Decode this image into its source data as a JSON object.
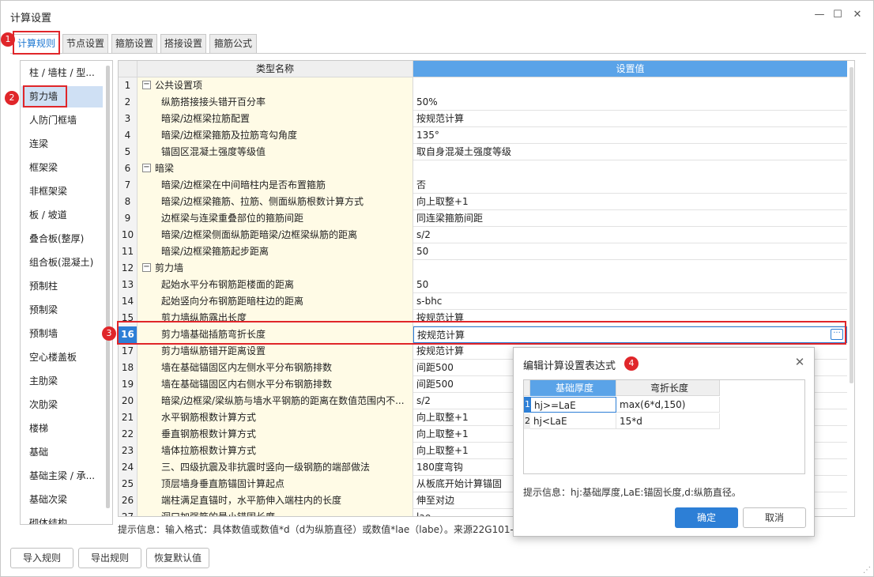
{
  "window": {
    "title": "计算设置",
    "min": "—",
    "max": "☐",
    "close": "✕"
  },
  "tabs": [
    "计算规则",
    "节点设置",
    "箍筋设置",
    "搭接设置",
    "箍筋公式"
  ],
  "categories": [
    "柱 / 墙柱 / 型...",
    "剪力墙",
    "人防门框墙",
    "连梁",
    "框架梁",
    "非框架梁",
    "板 / 坡道",
    "叠合板(整厚)",
    "组合板(混凝土)",
    "预制柱",
    "预制梁",
    "预制墙",
    "空心楼盖板",
    "主肋梁",
    "次肋梁",
    "楼梯",
    "基础",
    "基础主梁 / 承...",
    "基础次梁",
    "砌体结构"
  ],
  "grid": {
    "headers": {
      "name": "类型名称",
      "value": "设置值"
    },
    "rows": [
      {
        "n": "1",
        "name": "公共设置项",
        "value": "",
        "group": true
      },
      {
        "n": "2",
        "name": "纵筋搭接接头错开百分率",
        "value": "50%"
      },
      {
        "n": "3",
        "name": "暗梁/边框梁拉筋配置",
        "value": "按规范计算"
      },
      {
        "n": "4",
        "name": "暗梁/边框梁箍筋及拉筋弯勾角度",
        "value": "135°"
      },
      {
        "n": "5",
        "name": "锚固区混凝土强度等级值",
        "value": "取自身混凝土强度等级"
      },
      {
        "n": "6",
        "name": "暗梁",
        "value": "",
        "group": true
      },
      {
        "n": "7",
        "name": "暗梁/边框梁在中间暗柱内是否布置箍筋",
        "value": "否"
      },
      {
        "n": "8",
        "name": "暗梁/边框梁箍筋、拉筋、侧面纵筋根数计算方式",
        "value": "向上取整+1"
      },
      {
        "n": "9",
        "name": "边框梁与连梁重叠部位的箍筋间距",
        "value": "同连梁箍筋间距"
      },
      {
        "n": "10",
        "name": "暗梁/边框梁侧面纵筋距暗梁/边框梁纵筋的距离",
        "value": "s/2"
      },
      {
        "n": "11",
        "name": "暗梁/边框梁箍筋起步距离",
        "value": "50"
      },
      {
        "n": "12",
        "name": "剪力墙",
        "value": "",
        "group": true
      },
      {
        "n": "13",
        "name": "起始水平分布钢筋距楼面的距离",
        "value": "50"
      },
      {
        "n": "14",
        "name": "起始竖向分布钢筋距暗柱边的距离",
        "value": "s-bhc"
      },
      {
        "n": "15",
        "name": "剪力墙纵筋露出长度",
        "value": "按规范计算"
      },
      {
        "n": "16",
        "name": "剪力墙基础插筋弯折长度",
        "value": "按规范计算",
        "selected": true
      },
      {
        "n": "17",
        "name": "剪力墙纵筋错开距离设置",
        "value": "按规范计算"
      },
      {
        "n": "18",
        "name": "墙在基础锚固区内左侧水平分布钢筋排数",
        "value": "间距500"
      },
      {
        "n": "19",
        "name": "墙在基础锚固区内右侧水平分布钢筋排数",
        "value": "间距500"
      },
      {
        "n": "20",
        "name": "暗梁/边框梁/梁纵筋与墙水平钢筋的距离在数值范围内不...",
        "value": "s/2"
      },
      {
        "n": "21",
        "name": "水平钢筋根数计算方式",
        "value": "向上取整+1"
      },
      {
        "n": "22",
        "name": "垂直钢筋根数计算方式",
        "value": "向上取整+1"
      },
      {
        "n": "23",
        "name": "墙体拉筋根数计算方式",
        "value": "向上取整+1"
      },
      {
        "n": "24",
        "name": "三、四级抗震及非抗震时竖向一级钢筋的端部做法",
        "value": "180度弯钩"
      },
      {
        "n": "25",
        "name": "顶层墙身垂直筋锚固计算起点",
        "value": "从板底开始计算锚固"
      },
      {
        "n": "26",
        "name": "端柱满足直锚时，水平筋伸入端柱内的长度",
        "value": "伸至对边"
      },
      {
        "n": "27",
        "name": "洞口加强筋的最小锚固长度",
        "value": "lae"
      }
    ],
    "ellipsis": "···"
  },
  "hint": "提示信息：输入格式：具体数值或数值*d（d为纵筋直径）或数值*lae（labe）。来源22G101-",
  "buttons": {
    "import": "导入规则",
    "export": "导出规则",
    "restore": "恢复默认值"
  },
  "dialog": {
    "title": "编辑计算设置表达式",
    "close": "✕",
    "headers": [
      "基础厚度",
      "弯折长度"
    ],
    "rows": [
      {
        "n": "1",
        "cond": "hj>=LaE",
        "len": "max(6*d,150)"
      },
      {
        "n": "2",
        "cond": "hj<LaE",
        "len": "15*d"
      }
    ],
    "hint": "提示信息：hj:基础厚度,LaE:锚固长度,d:纵筋直径。",
    "ok": "确定",
    "cancel": "取消"
  },
  "callouts": [
    "1",
    "2",
    "3",
    "4"
  ],
  "colors": {
    "accent": "#1e78d2",
    "highlight": "#e0262a",
    "header_blue": "#5aa3e8",
    "selected_row": "#2d7fd6",
    "name_bg": "#fffbe6"
  }
}
